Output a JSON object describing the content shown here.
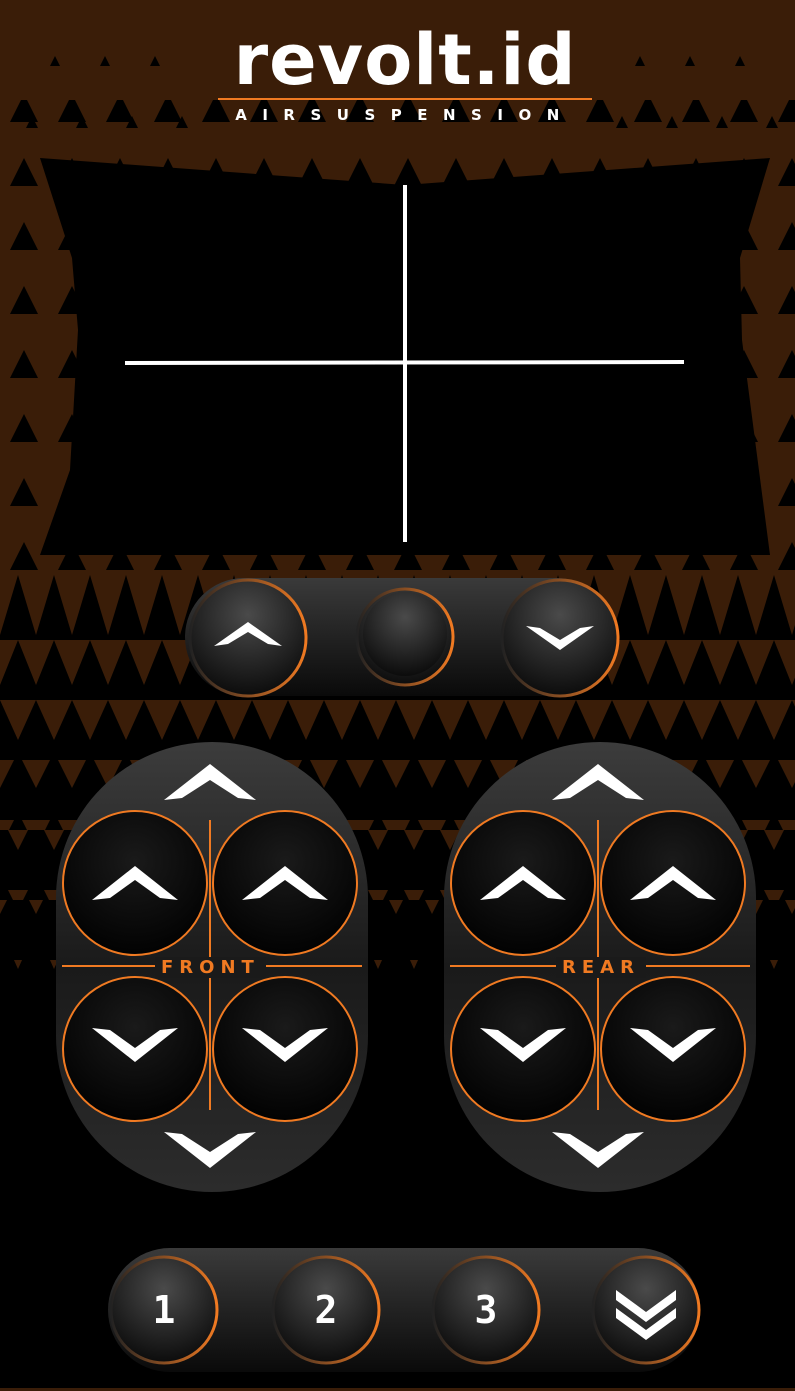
{
  "brand": {
    "name": "revolt.id",
    "tagline": "AIRSUSPENSION",
    "accent": "#f07a22",
    "background": "#3a1d08"
  },
  "level_display": {
    "crosshair": "crosshair-icon"
  },
  "all_corners": {
    "up_icon": "chevron-up-icon",
    "stop_icon": "circle-icon",
    "down_icon": "chevron-down-icon"
  },
  "front": {
    "label": "FRONT",
    "axle_up_icon": "chevron-up-icon",
    "axle_down_icon": "chevron-down-icon"
  },
  "rear": {
    "label": "REAR",
    "axle_up_icon": "chevron-up-icon",
    "axle_down_icon": "chevron-down-icon"
  },
  "presets": {
    "items": [
      {
        "label": "1"
      },
      {
        "label": "2"
      },
      {
        "label": "3"
      }
    ],
    "lower_all_icon": "double-chevron-down-icon"
  }
}
